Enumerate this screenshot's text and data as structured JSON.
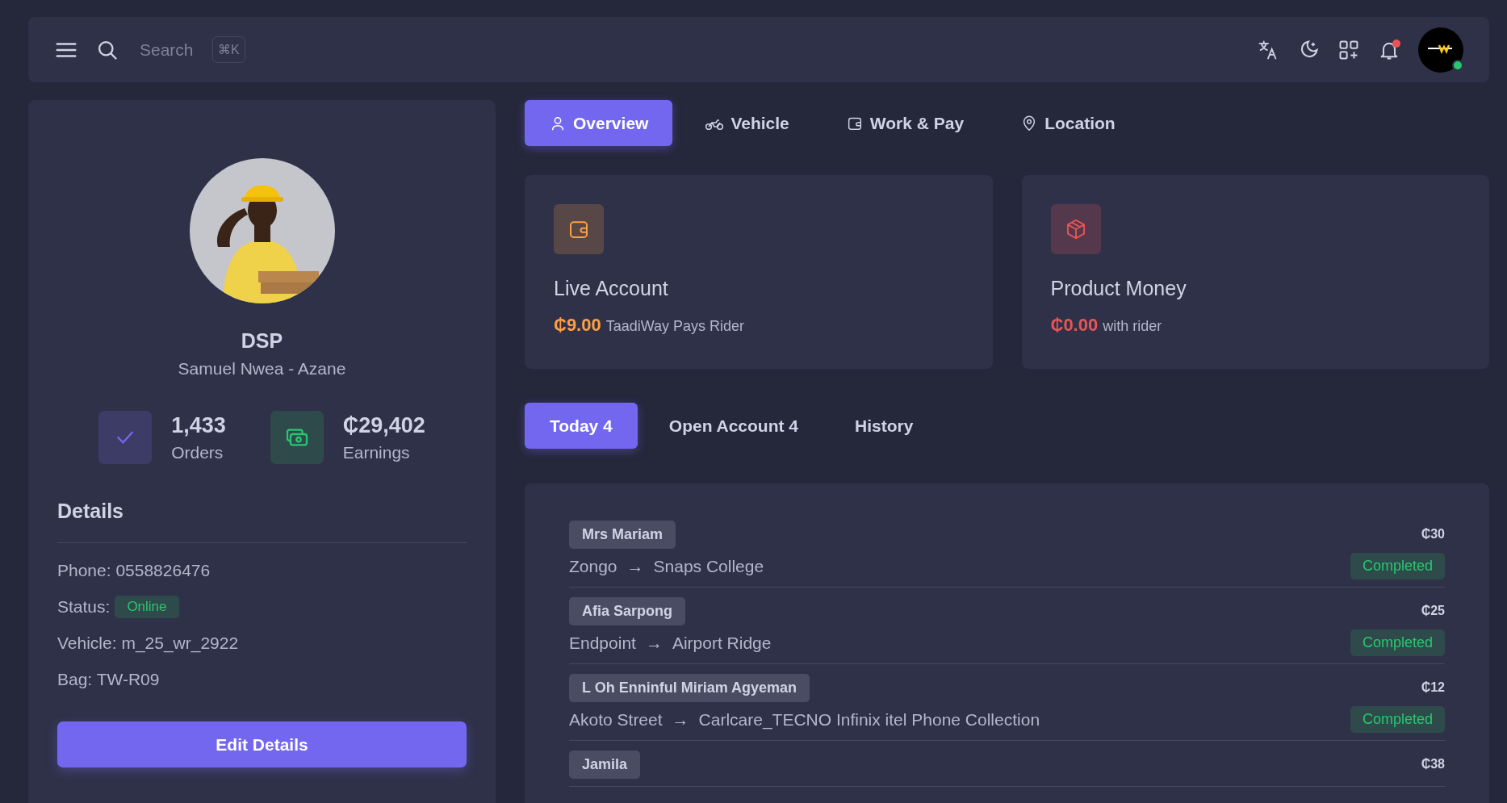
{
  "topbar": {
    "search": {
      "placeholder": "Search",
      "shortcut": "⌘K"
    },
    "notification_unread": true,
    "user_online": true
  },
  "profile": {
    "role": "DSP",
    "name": "Samuel Nwea - Azane",
    "stats": [
      {
        "kind": "orders",
        "value": "1,433",
        "label": "Orders"
      },
      {
        "kind": "earnings",
        "value": "₵29,402",
        "label": "Earnings"
      }
    ],
    "details_title": "Details",
    "details": [
      {
        "label": "Phone:",
        "value": "0558826476"
      },
      {
        "label": "Status:",
        "badge": "Online"
      },
      {
        "label": "Vehicle:",
        "value": "m_25_wr_2922"
      },
      {
        "label": "Bag:",
        "value": "TW-R09"
      }
    ],
    "edit_button": "Edit Details"
  },
  "tabs": [
    {
      "kind": "user",
      "label": "Overview",
      "selected": true
    },
    {
      "kind": "bike",
      "label": "Vehicle",
      "selected": false
    },
    {
      "kind": "wallet",
      "label": "Work & Pay",
      "selected": false
    },
    {
      "kind": "pin",
      "label": "Location",
      "selected": false
    }
  ],
  "cards": [
    {
      "kind": "wallet",
      "title": "Live Account",
      "amount": "₵9.00",
      "note": "TaadiWay Pays Rider",
      "color": "#ff9f43"
    },
    {
      "kind": "box",
      "title": "Product Money",
      "amount": "₵0.00",
      "note": "with rider",
      "color": "#ea5455"
    }
  ],
  "order_tabs": [
    {
      "label": "Today 4",
      "selected": true
    },
    {
      "label": "Open Account 4",
      "selected": false
    },
    {
      "label": "History",
      "selected": false
    }
  ],
  "orders": [
    {
      "customer": "Mrs Mariam",
      "amount": "₵30",
      "from": "Zongo",
      "arrow": "→",
      "to": "Snaps College",
      "status": "Completed"
    },
    {
      "customer": "Afia Sarpong",
      "amount": "₵25",
      "from": "Endpoint",
      "arrow": "→",
      "to": "Airport Ridge",
      "status": "Completed"
    },
    {
      "customer": "L Oh Enninful Miriam Agyeman",
      "amount": "₵12",
      "from": "Akoto Street",
      "arrow": "→",
      "to": "Carlcare_TECNO Infinix itel Phone Collection",
      "status": "Completed"
    },
    {
      "customer": "Jamila",
      "amount": "₵38"
    }
  ]
}
